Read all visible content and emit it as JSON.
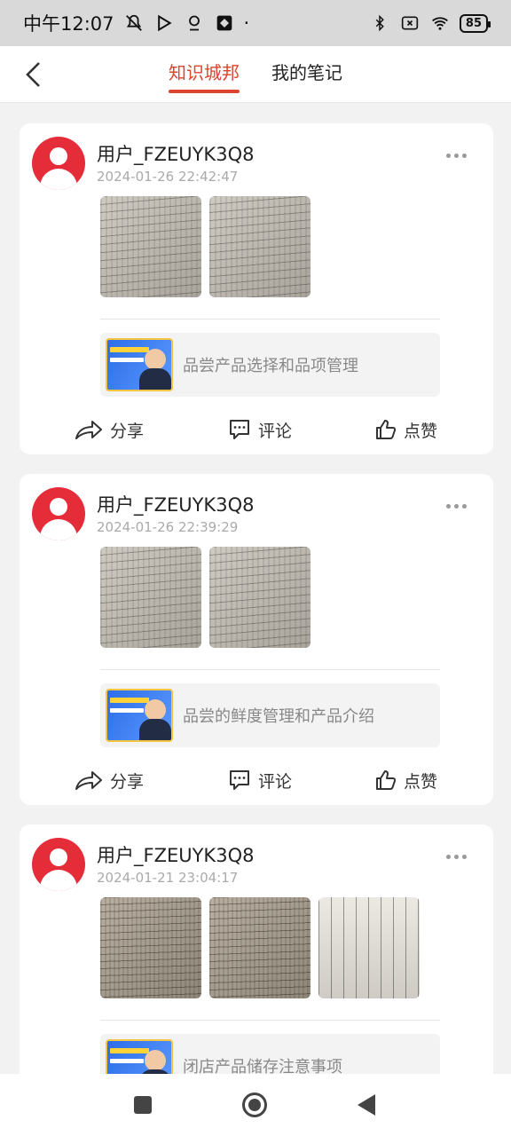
{
  "status_bar": {
    "time": "中午12:07",
    "dot": "·",
    "battery": "85",
    "icons": [
      "mute-icon",
      "play-icon",
      "hotspot-icon",
      "app-icon",
      "bluetooth-icon",
      "sim-icon",
      "wifi-icon"
    ]
  },
  "header": {
    "tabs": [
      {
        "label": "知识城邦",
        "active": true
      },
      {
        "label": "我的笔记",
        "active": false
      }
    ]
  },
  "posts": [
    {
      "user": "用户_FZEUYK3Q8",
      "time": "2024-01-26 22:42:47",
      "course": "品尝产品选择和品项管理",
      "photo_count": 2
    },
    {
      "user": "用户_FZEUYK3Q8",
      "time": "2024-01-26 22:39:29",
      "course": "品尝的鲜度管理和产品介绍",
      "photo_count": 2
    },
    {
      "user": "用户_FZEUYK3Q8",
      "time": "2024-01-21 23:04:17",
      "course": "闭店产品储存注意事项",
      "photo_count": 3
    }
  ],
  "actions": {
    "share": "分享",
    "comment": "评论",
    "like": "点赞"
  },
  "colors": {
    "accent": "#d9452e",
    "avatar": "#e52d3a",
    "status_bar": "#d9d9d9",
    "background": "#f2f2f2"
  }
}
